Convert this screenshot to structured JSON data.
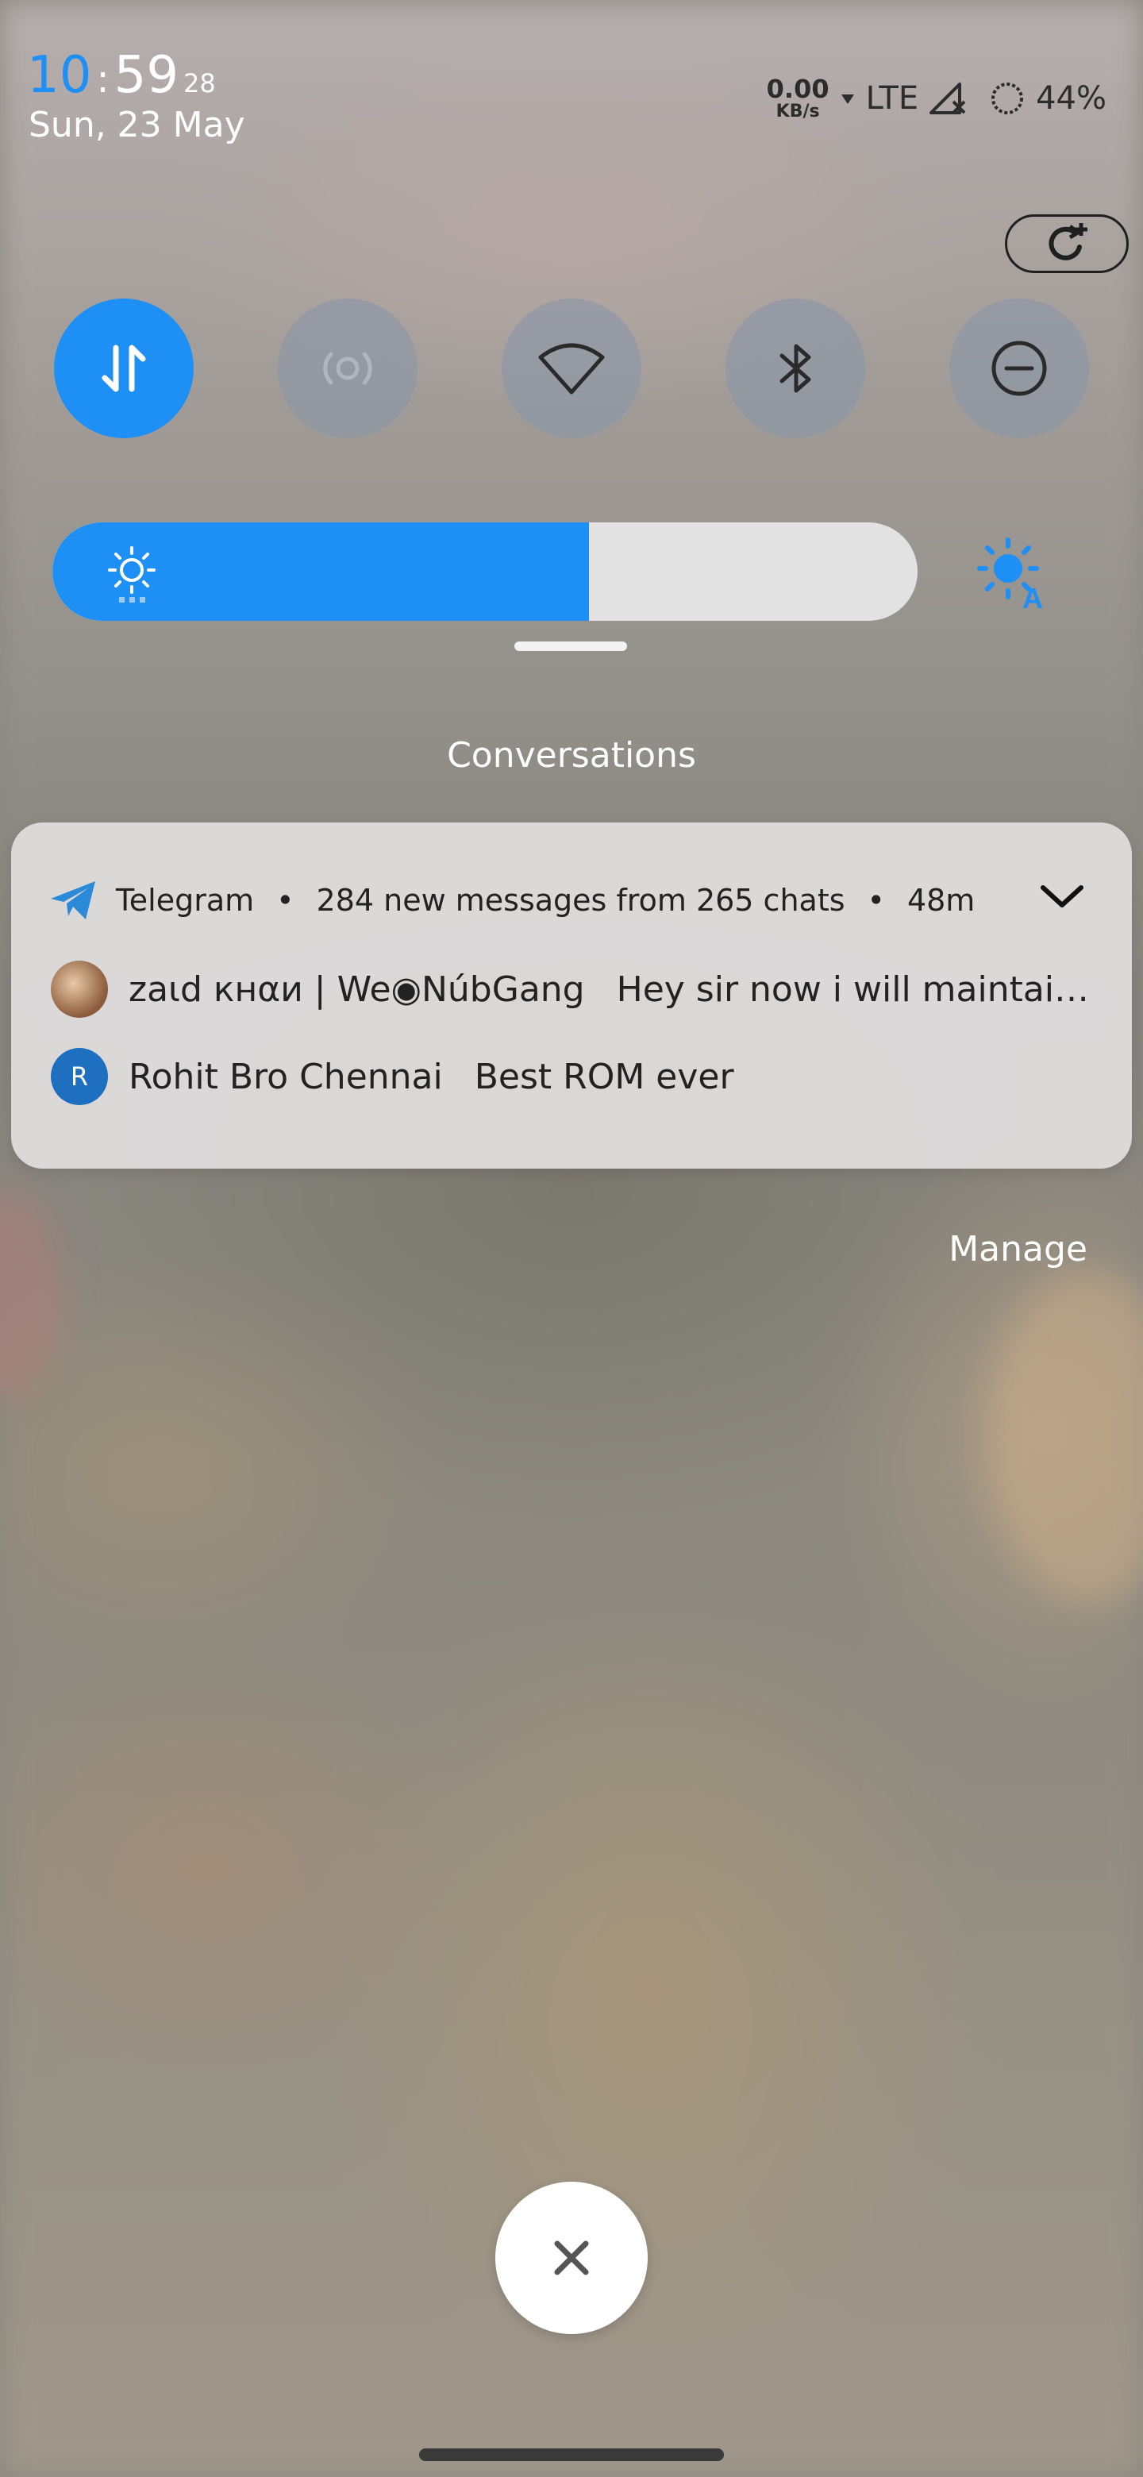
{
  "status_bar": {
    "hour": "10",
    "separator": ":",
    "minute": "59",
    "seconds": "28",
    "date": "Sun, 23 May",
    "net_speed_value": "0.00",
    "net_speed_unit": "KB/s",
    "network_type": "LTE",
    "battery_percent": "44%"
  },
  "quick_settings": {
    "tiles": [
      {
        "name": "mobile-data",
        "icon": "data-arrows-icon",
        "active": true
      },
      {
        "name": "hotspot",
        "icon": "hotspot-icon",
        "active": false
      },
      {
        "name": "wifi",
        "icon": "wifi-icon",
        "active": false
      },
      {
        "name": "bluetooth",
        "icon": "bluetooth-icon",
        "active": false
      },
      {
        "name": "do-not-disturb",
        "icon": "dnd-icon",
        "active": false
      }
    ],
    "brightness_level": 0.62,
    "accent_color": "#1e8ff5"
  },
  "notifications": {
    "section_title": "Conversations",
    "card": {
      "app_name": "Telegram",
      "summary": "284 new messages from 265 chats",
      "time": "48m",
      "messages": [
        {
          "sender": "zaιd кнαи | We◉NúbGang",
          "text": "Hey sir now i will maintain...",
          "avatar_letter": "",
          "avatar_color": "#8a5a3a"
        },
        {
          "sender": "Rohit Bro Chennai",
          "text": "Best ROM ever",
          "avatar_letter": "R",
          "avatar_color": "#1e6fbf"
        }
      ]
    },
    "manage_label": "Manage"
  }
}
